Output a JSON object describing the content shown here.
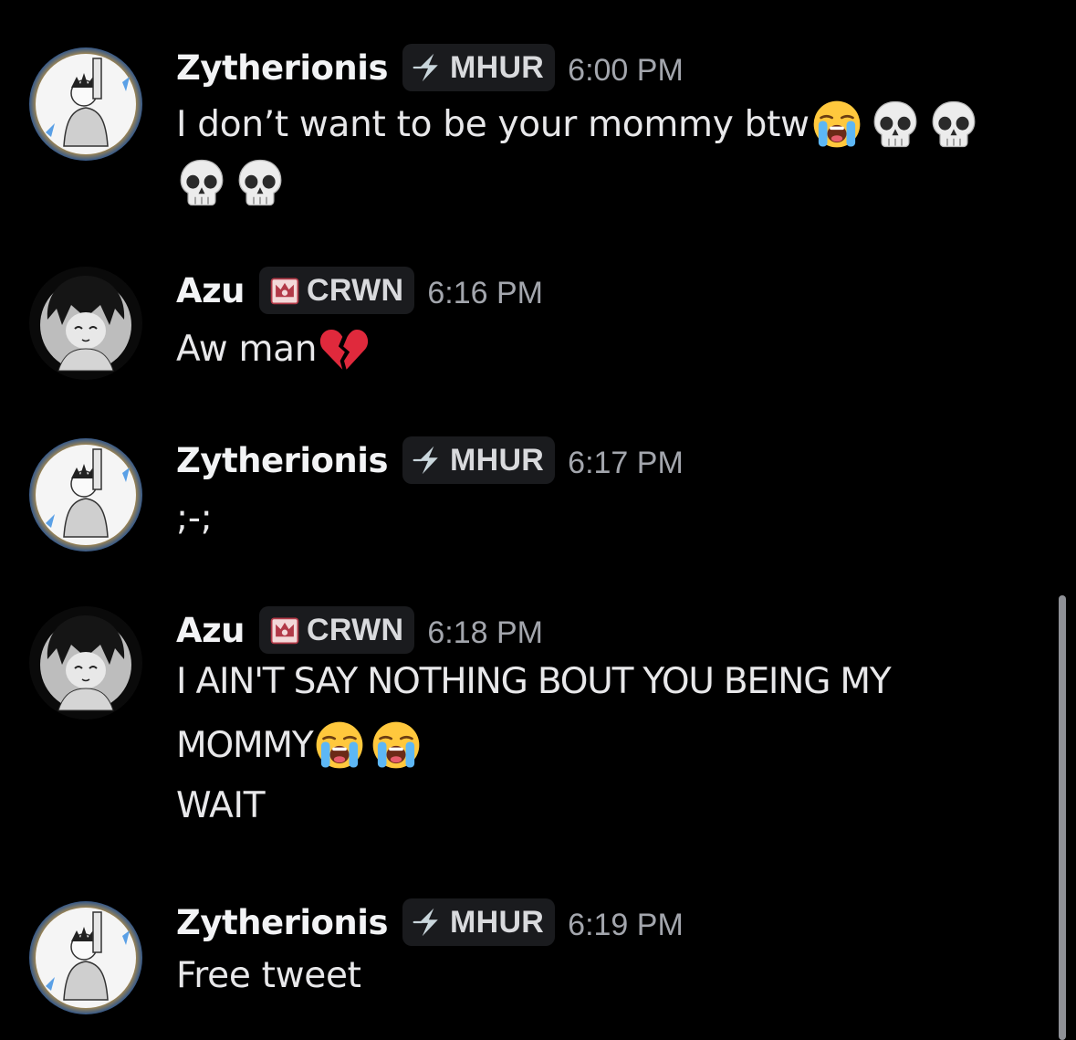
{
  "messages": [
    {
      "author": "Zytherionis",
      "tag": "MHUR",
      "tag_icon": "lightning-icon",
      "time": "6:00 PM",
      "lines": [
        {
          "text": "I don’t want to be your mommy btw",
          "emojis": [
            "loudly-crying-emoji",
            "skull-emoji",
            "skull-emoji"
          ]
        },
        {
          "text": "",
          "emojis": [
            "skull-emoji",
            "skull-emoji"
          ]
        }
      ]
    },
    {
      "author": "Azu",
      "tag": "CRWN",
      "tag_icon": "crown-badge-icon",
      "time": "6:16 PM",
      "lines": [
        {
          "text": "Aw man",
          "emojis": [
            "broken-heart-emoji"
          ]
        }
      ]
    },
    {
      "author": "Zytherionis",
      "tag": "MHUR",
      "tag_icon": "lightning-icon",
      "time": "6:17 PM",
      "lines": [
        {
          "text": ";-;",
          "emojis": []
        }
      ]
    },
    {
      "author": "Azu",
      "tag": "CRWN",
      "tag_icon": "crown-badge-icon",
      "time": "6:18 PM",
      "lines": [
        {
          "text": "I AIN'T SAY NOTHING BOUT YOU BEING MY",
          "emojis": []
        },
        {
          "text": "MOMMY",
          "emojis": [
            "loudly-crying-emoji",
            "loudly-crying-emoji"
          ]
        },
        {
          "text": "WAIT",
          "emojis": []
        }
      ]
    },
    {
      "author": "Zytherionis",
      "tag": "MHUR",
      "tag_icon": "lightning-icon",
      "time": "6:19 PM",
      "lines": [
        {
          "text": "Free tweet",
          "emojis": []
        }
      ]
    }
  ],
  "colors": {
    "background": "#000000",
    "username": "#f2f3f5",
    "message_text": "#e8e8ea",
    "timestamp": "#a3a6ad",
    "tag_background": "#1a1b1e",
    "tag_text": "#d9dadd",
    "scrollbar": "#8e9096"
  }
}
